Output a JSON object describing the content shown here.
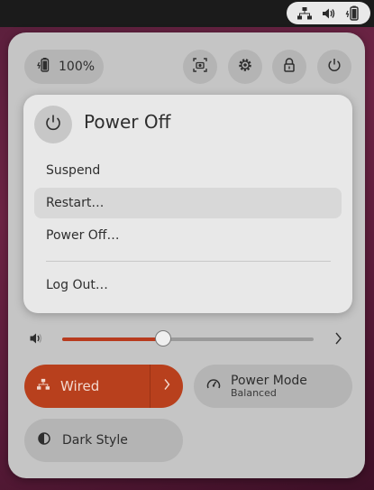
{
  "top_bar": {
    "tray_icons": [
      "network-wired-icon",
      "volume-icon",
      "battery-icon"
    ]
  },
  "quick_settings": {
    "battery": {
      "label": "100%",
      "icon": "battery-icon"
    },
    "header_buttons": [
      "screenshot-icon",
      "gear-icon",
      "lock-icon",
      "power-icon"
    ],
    "power_menu": {
      "title": "Power Off",
      "items": [
        {
          "label": "Suspend"
        },
        {
          "label": "Restart…"
        },
        {
          "label": "Power Off…"
        },
        {
          "label": "Log Out…"
        }
      ],
      "hovered_index": 1
    },
    "volume": {
      "level_fraction": 0.4
    },
    "toggles": {
      "wired": {
        "label": "Wired",
        "active": true
      },
      "power_mode": {
        "label": "Power Mode",
        "subtitle": "Balanced"
      },
      "dark_style": {
        "label": "Dark Style"
      }
    },
    "colors": {
      "accent": "#b8401d",
      "panel_bg": "#c5c5c5",
      "menu_bg": "#e8e8e8",
      "topbar_bg": "#1b1b1b"
    }
  }
}
